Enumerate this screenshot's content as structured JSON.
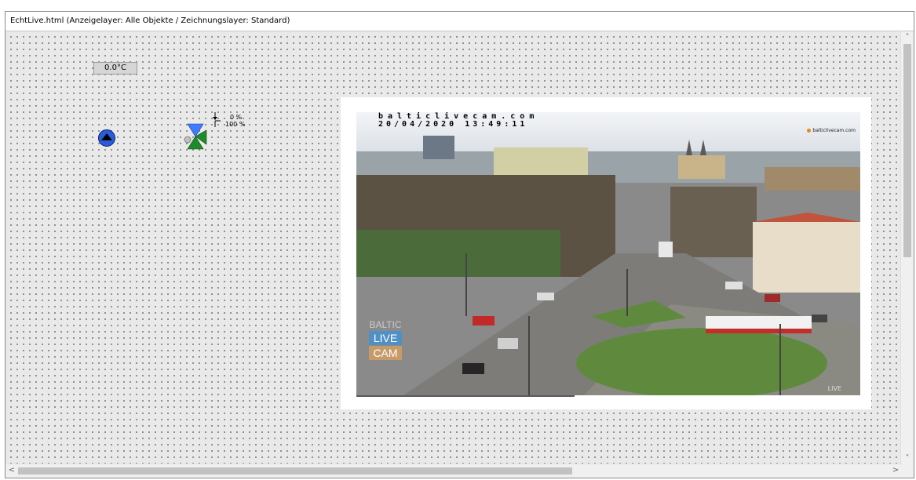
{
  "window": {
    "title": "EchtLive.html  (Anzeigelayer: Alle Objekte / Zeichnungslayer: Standard)"
  },
  "widgets": {
    "temperature": "0.0°C",
    "valve": {
      "label_top": "0 %",
      "label_bottom": "100 %"
    }
  },
  "webcam": {
    "url_text": "balticlivecam.com",
    "datetime_text": "20/04/2020 13:49:11",
    "logo_line1": "BALTIC",
    "logo_line2": "LIVE",
    "logo_line3": "CAM",
    "badge_text": "balticlivecam.com",
    "live_text": "LIVE"
  },
  "scrollbars": {
    "up_icon": "chevron-up-icon",
    "down_icon": "chevron-down-icon",
    "left_icon": "chevron-left-icon",
    "right_icon": "chevron-right-icon"
  },
  "colors": {
    "pump_blue": "#2a5bd8",
    "valve_blue": "#3e7bff",
    "valve_green": "#1f8a2c"
  }
}
